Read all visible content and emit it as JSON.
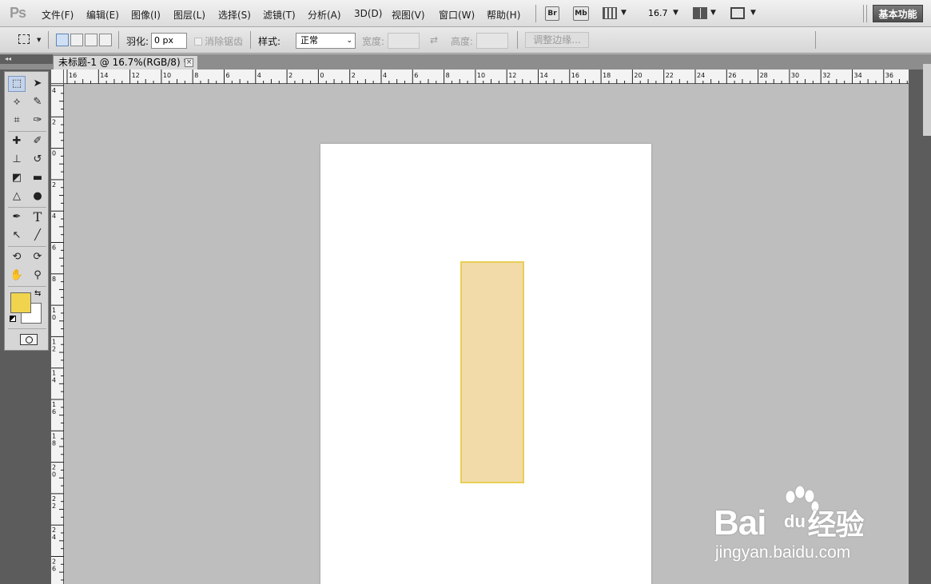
{
  "app": {
    "logo": "Ps"
  },
  "menubar": {
    "items": [
      "文件(F)",
      "编辑(E)",
      "图像(I)",
      "图层(L)",
      "选择(S)",
      "滤镜(T)",
      "分析(A)",
      "3D(D)",
      "视图(V)",
      "窗口(W)",
      "帮助(H)"
    ],
    "bridge_button": "Br",
    "minibridge_button": "Mb",
    "zoom_value": "16.7",
    "workspace_button": "基本功能"
  },
  "options": {
    "feather_label": "羽化:",
    "feather_value": "0 px",
    "antialias_label": "消除锯齿",
    "style_label": "样式:",
    "style_value": "正常",
    "width_label": "宽度:",
    "height_label": "高度:",
    "refine_edge_label": "调整边缘..."
  },
  "document": {
    "tab_title": "未标题-1 @ 16.7%(RGB/8) *",
    "close_glyph": "×",
    "rect_fill": "#f2dba9",
    "rect_stroke": "#e8cf55"
  },
  "ruler": {
    "h_labels": [
      "16",
      "14",
      "12",
      "10",
      "8",
      "6",
      "4",
      "2",
      "0",
      "2",
      "4",
      "6",
      "8",
      "10",
      "12",
      "14",
      "16",
      "18",
      "20",
      "22",
      "24",
      "26",
      "28",
      "30",
      "32",
      "34",
      "36"
    ],
    "v_labels": [
      "4",
      "2",
      "0",
      "2",
      "4",
      "6",
      "8",
      "1 0",
      "1 2",
      "1 4",
      "1 6",
      "1 8",
      "2 0",
      "2 2",
      "2 4",
      "2 6"
    ]
  },
  "colors": {
    "foreground": "#f0d44e",
    "background": "#ffffff"
  },
  "watermark": {
    "brand": "Bai经验",
    "url": "jingyan.baidu.com",
    "du": "du"
  }
}
